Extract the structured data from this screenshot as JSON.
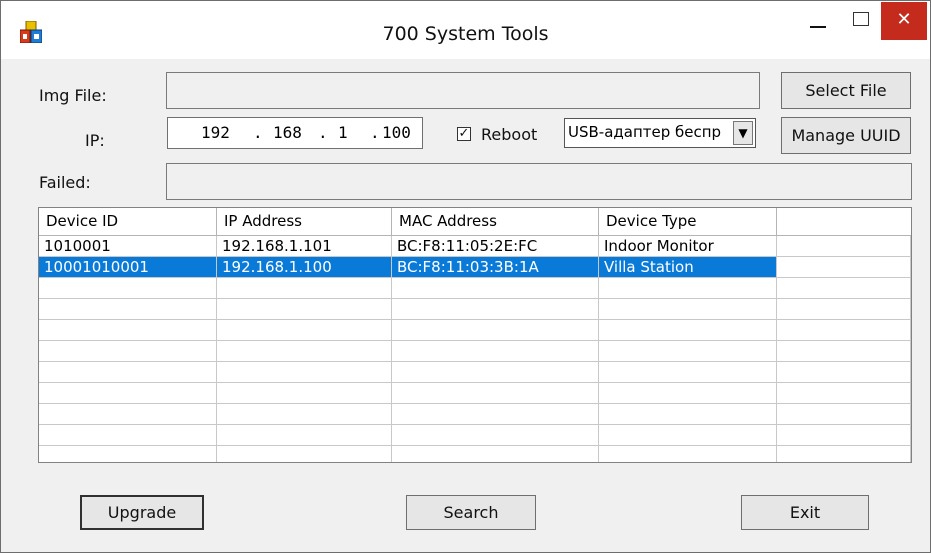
{
  "window": {
    "title": "700 System Tools"
  },
  "form": {
    "img_file_label": "Img File:",
    "ip_label": "IP:",
    "failed_label": "Failed:",
    "ip_octets": [
      "192",
      "168",
      "1",
      "100"
    ],
    "ip_dot": ".",
    "reboot_label": "Reboot",
    "reboot_checked": true,
    "reboot_check_glyph": "✓",
    "adapter_value": "USB-адаптер беспр"
  },
  "buttons": {
    "select_file": "Select File",
    "manage_uuid": "Manage UUID",
    "upgrade": "Upgrade",
    "search": "Search",
    "exit": "Exit"
  },
  "table": {
    "columns": [
      "Device ID",
      "IP Address",
      "MAC Address",
      "Device Type",
      ""
    ],
    "rows": [
      [
        "1010001",
        "192.168.1.101",
        "BC:F8:11:05:2E:FC",
        "Indoor Monitor",
        ""
      ],
      [
        "10001010001",
        "192.168.1.100",
        "BC:F8:11:03:3B:1A",
        "Villa Station",
        ""
      ]
    ],
    "selected_row": 1
  },
  "icons": {
    "app": "app-icon",
    "minimize": "minimize-icon",
    "maximize": "maximize-icon",
    "close": "close-icon",
    "dropdown": "chevron-down-icon"
  },
  "colors": {
    "selection": "#0a7ad8",
    "close_button": "#c42b1c"
  }
}
